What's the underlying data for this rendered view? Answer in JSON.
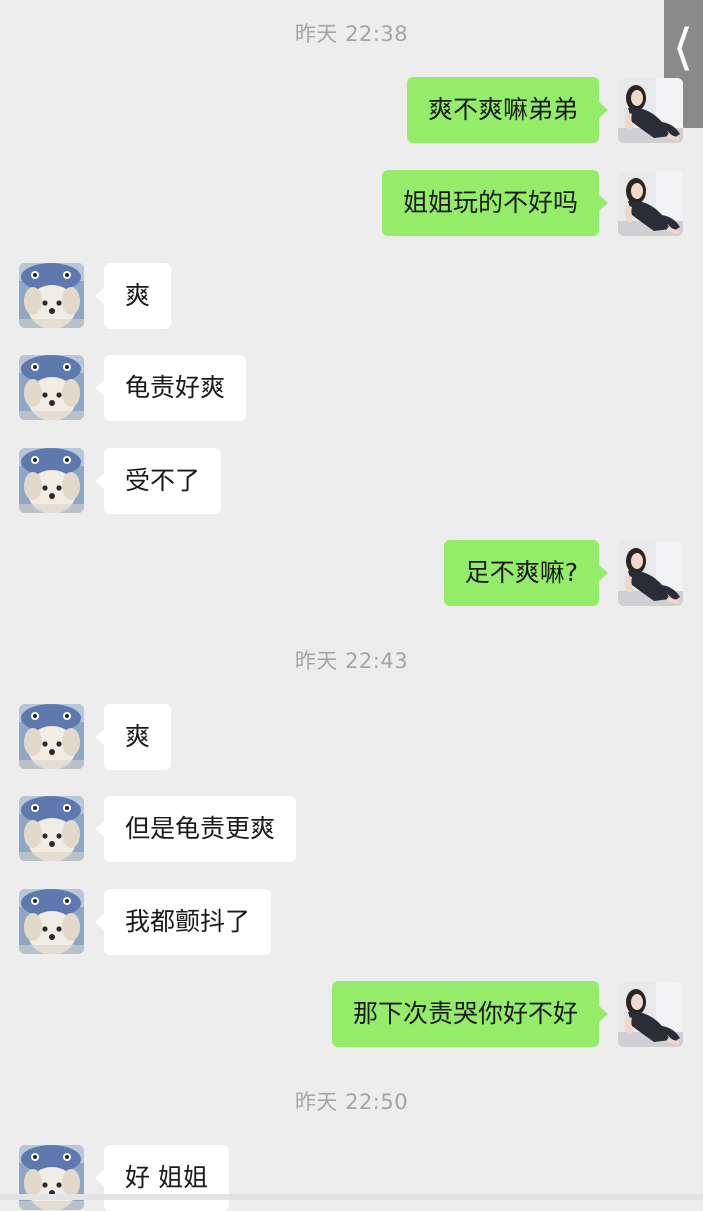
{
  "nav": {
    "back_icon": "chevron-left-icon",
    "back_glyph": "❬"
  },
  "colors": {
    "background": "#ededed",
    "incoming_bubble": "#ffffff",
    "outgoing_bubble": "#95ec69",
    "timestamp": "#a5a5a5"
  },
  "timestamps": [
    "昨天 22:38",
    "昨天 22:43",
    "昨天 22:50"
  ],
  "messages": [
    {
      "side": "right",
      "text": "爽不爽嘛弟弟"
    },
    {
      "side": "right",
      "text": "姐姐玩的不好吗"
    },
    {
      "side": "left",
      "text": "爽"
    },
    {
      "side": "left",
      "text": "龟责好爽"
    },
    {
      "side": "left",
      "text": "受不了"
    },
    {
      "side": "right",
      "text": "足不爽嘛?"
    },
    {
      "side": "left",
      "text": "爽"
    },
    {
      "side": "left",
      "text": "但是龟责更爽"
    },
    {
      "side": "left",
      "text": "我都颤抖了"
    },
    {
      "side": "right",
      "text": "那下次责哭你好不好"
    },
    {
      "side": "left",
      "text": "好 姐姐"
    }
  ]
}
